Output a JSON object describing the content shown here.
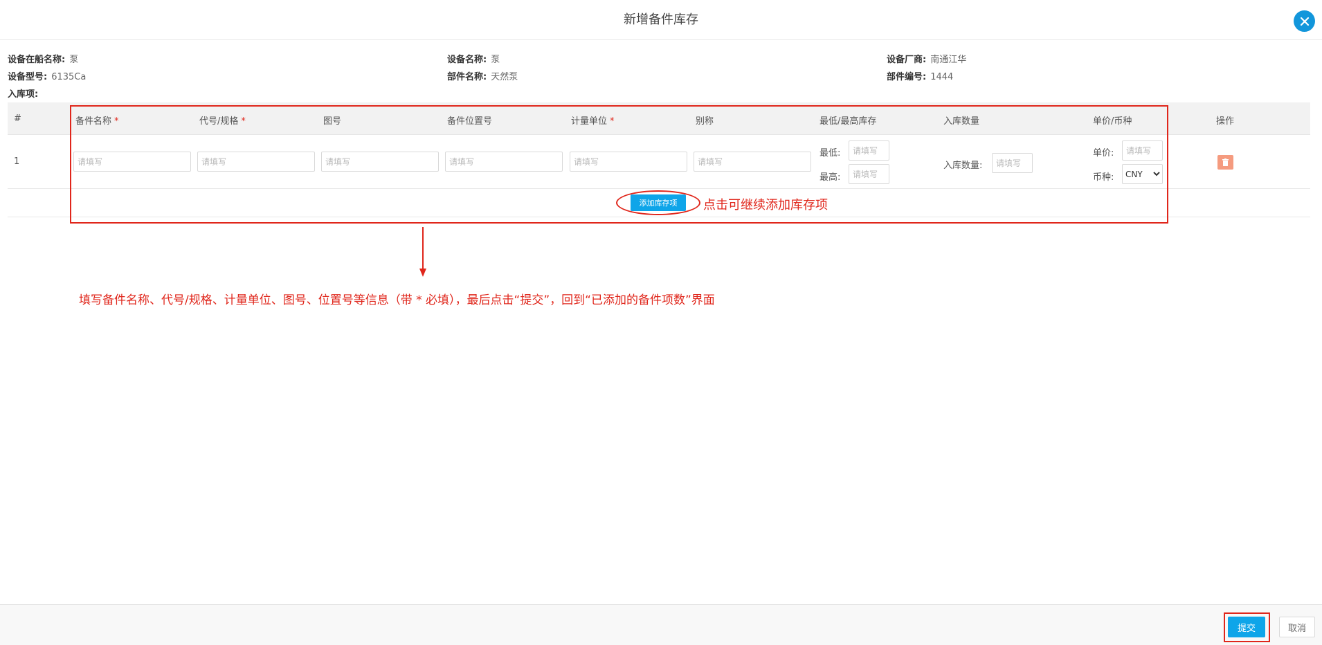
{
  "dialog": {
    "title": "新增备件库存"
  },
  "info": {
    "ship_name_label": "设备在船名称:",
    "ship_name_value": "泵",
    "device_name_label": "设备名称:",
    "device_name_value": "泵",
    "vendor_label": "设备厂商:",
    "vendor_value": "南通江华",
    "model_label": "设备型号:",
    "model_value": "6135Ca",
    "part_name_label": "部件名称:",
    "part_name_value": "天然泵",
    "part_no_label": "部件编号:",
    "part_no_value": "1444",
    "stock_items_label": "入库项:"
  },
  "table": {
    "headers": [
      "#",
      "备件名称",
      "代号/规格",
      "图号",
      "备件位置号",
      "计量单位",
      "别称",
      "最低/最高库存",
      "入库数量",
      "单价/币种",
      "操作"
    ],
    "required_mark": "*",
    "row": {
      "index": "1",
      "placeholder": "请填写",
      "min_label": "最低:",
      "max_label": "最高:",
      "qty_label": "入库数量:",
      "price_label": "单价:",
      "currency_label": "币种:",
      "currency_value": "CNY"
    },
    "add_button": "添加库存项"
  },
  "annotations": {
    "add_hint": "点击可继续添加库存项",
    "main_hint": "填写备件名称、代号/规格、计量单位、图号、位置号等信息（带 * 必填），最后点击“提交”，回到“已添加的备件项数”界面",
    "color": "#e0261b"
  },
  "footer": {
    "submit": "提交",
    "cancel": "取消"
  },
  "colors": {
    "primary": "#0ea5e9",
    "delete": "#f59b7f",
    "header_bg": "#f2f2f2"
  }
}
